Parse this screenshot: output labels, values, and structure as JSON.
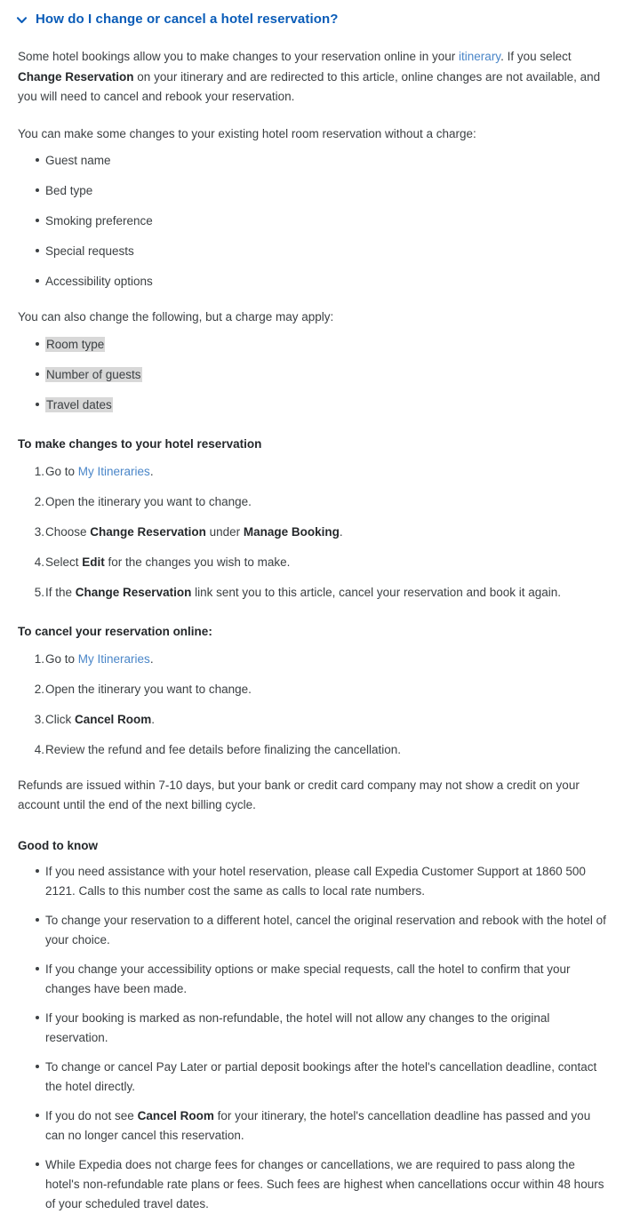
{
  "header": {
    "title": "How do I change or cancel a hotel reservation?",
    "chevron_icon": "chevron-down-icon",
    "title_color": "#0a5cb8"
  },
  "intro": {
    "p1_a": "Some hotel bookings allow you to make changes to your reservation online in your ",
    "p1_link": "itinerary",
    "p1_b": ". If you select ",
    "p1_bold": "Change Reservation",
    "p1_c": " on your itinerary and are redirected to this article, online changes are not available, and you will need to cancel and rebook your reservation."
  },
  "free_changes": {
    "lead": "You can make some changes to your existing hotel room reservation without a charge:",
    "items": [
      "Guest name",
      "Bed type",
      "Smoking preference",
      "Special requests",
      "Accessibility options"
    ]
  },
  "charged_changes": {
    "lead": "You can also change the following, but a charge may apply:",
    "items": [
      "Room type",
      "Number of guests",
      "Travel dates"
    ],
    "highlight_color": "#d8d8d8"
  },
  "make_changes": {
    "heading": "To make changes to your hotel reservation",
    "steps": [
      {
        "pre": "Go to ",
        "link": "My Itineraries",
        "post": "."
      },
      {
        "pre": "Open the itinerary you want to change.",
        "link": "",
        "post": ""
      },
      {
        "pre": "Choose ",
        "bold": "Change Reservation",
        "mid": " under ",
        "bold2": "Manage Booking",
        "post": "."
      },
      {
        "pre": "Select ",
        "bold": "Edit",
        "post": " for the changes you wish to make."
      },
      {
        "pre": "If the ",
        "bold": "Change Reservation",
        "post": " link sent you to this article, cancel your reservation and book it again."
      }
    ]
  },
  "cancel_online": {
    "heading": "To cancel your reservation online:",
    "steps": [
      {
        "pre": "Go to ",
        "link": "My Itineraries",
        "post": "."
      },
      {
        "pre": "Open the itinerary you want to change.",
        "link": "",
        "post": ""
      },
      {
        "pre": "Click ",
        "bold": "Cancel Room",
        "post": "."
      },
      {
        "pre": "Review the refund and fee details before finalizing the cancellation.",
        "post": ""
      }
    ]
  },
  "refunds": {
    "text": "Refunds are issued within 7-10 days, but your bank or credit card company may not show a credit on your account until the end of the next billing cycle."
  },
  "good_to_know": {
    "heading": "Good to know",
    "items": [
      {
        "pre": "If you need assistance with your hotel reservation, please call Expedia Customer Support at 1860 500 2121. Calls to this number cost the same as calls to local rate numbers."
      },
      {
        "pre": "To change your reservation to a different hotel, cancel the original reservation and rebook with the hotel of your choice."
      },
      {
        "pre": "If you change your accessibility options or make special requests, call the hotel to confirm that your changes have been made."
      },
      {
        "pre": "If your booking is marked as non-refundable, the hotel will not allow any changes to the original reservation."
      },
      {
        "pre": "To change or cancel Pay Later or partial deposit bookings after the hotel's cancellation deadline, contact the hotel directly."
      },
      {
        "pre": "If you do not see ",
        "bold": "Cancel Room",
        "post": " for your itinerary, the hotel's cancellation deadline has passed and you can no longer cancel this reservation."
      },
      {
        "pre": "While Expedia does not charge fees for changes or cancellations, we are required to pass along the hotel's non-refundable rate plans or fees. Such fees are highest when cancellations occur within 48 hours of your scheduled travel dates."
      }
    ]
  }
}
